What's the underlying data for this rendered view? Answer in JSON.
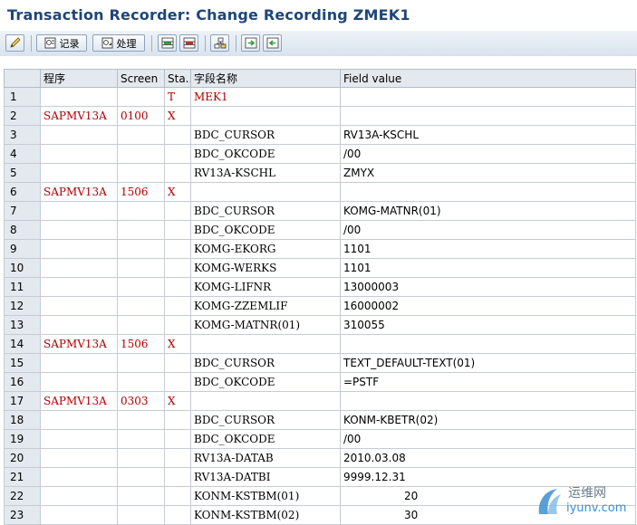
{
  "window": {
    "title": "Transaction Recorder: Change Recording ZMEK1"
  },
  "toolbar": {
    "record_label": "记录",
    "process_label": "处理",
    "accent": "#1e4678"
  },
  "columns": [
    "",
    "程序",
    "Screen",
    "Sta...",
    "字段名称",
    "Field value"
  ],
  "rows": [
    {
      "n": "1",
      "program": "",
      "screen": "",
      "start": "T",
      "field": "MEK1",
      "value": "",
      "field_red": true
    },
    {
      "n": "2",
      "program": "SAPMV13A",
      "screen": "0100",
      "start": "X",
      "field": "",
      "value": ""
    },
    {
      "n": "3",
      "program": "",
      "screen": "",
      "start": "",
      "field": "BDC_CURSOR",
      "value": "RV13A-KSCHL"
    },
    {
      "n": "4",
      "program": "",
      "screen": "",
      "start": "",
      "field": "BDC_OKCODE",
      "value": "/00"
    },
    {
      "n": "5",
      "program": "",
      "screen": "",
      "start": "",
      "field": "RV13A-KSCHL",
      "value": "ZMYX"
    },
    {
      "n": "6",
      "program": "SAPMV13A",
      "screen": "1506",
      "start": "X",
      "field": "",
      "value": ""
    },
    {
      "n": "7",
      "program": "",
      "screen": "",
      "start": "",
      "field": "BDC_CURSOR",
      "value": "KOMG-MATNR(01)"
    },
    {
      "n": "8",
      "program": "",
      "screen": "",
      "start": "",
      "field": "BDC_OKCODE",
      "value": "/00"
    },
    {
      "n": "9",
      "program": "",
      "screen": "",
      "start": "",
      "field": "KOMG-EKORG",
      "value": "1101"
    },
    {
      "n": "10",
      "program": "",
      "screen": "",
      "start": "",
      "field": "KOMG-WERKS",
      "value": "1101"
    },
    {
      "n": "11",
      "program": "",
      "screen": "",
      "start": "",
      "field": "KOMG-LIFNR",
      "value": "13000003"
    },
    {
      "n": "12",
      "program": "",
      "screen": "",
      "start": "",
      "field": "KOMG-ZZEMLIF",
      "value": "16000002"
    },
    {
      "n": "13",
      "program": "",
      "screen": "",
      "start": "",
      "field": "KOMG-MATNR(01)",
      "value": "310055"
    },
    {
      "n": "14",
      "program": "SAPMV13A",
      "screen": "1506",
      "start": "X",
      "field": "",
      "value": ""
    },
    {
      "n": "15",
      "program": "",
      "screen": "",
      "start": "",
      "field": "BDC_CURSOR",
      "value": "TEXT_DEFAULT-TEXT(01)"
    },
    {
      "n": "16",
      "program": "",
      "screen": "",
      "start": "",
      "field": "BDC_OKCODE",
      "value": "=PSTF"
    },
    {
      "n": "17",
      "program": "SAPMV13A",
      "screen": "0303",
      "start": "X",
      "field": "",
      "value": ""
    },
    {
      "n": "18",
      "program": "",
      "screen": "",
      "start": "",
      "field": "BDC_CURSOR",
      "value": "KONM-KBETR(02)"
    },
    {
      "n": "19",
      "program": "",
      "screen": "",
      "start": "",
      "field": "BDC_OKCODE",
      "value": "/00"
    },
    {
      "n": "20",
      "program": "",
      "screen": "",
      "start": "",
      "field": "RV13A-DATAB",
      "value": "2010.03.08"
    },
    {
      "n": "21",
      "program": "",
      "screen": "",
      "start": "",
      "field": "RV13A-DATBI",
      "value": "9999.12.31"
    },
    {
      "n": "22",
      "program": "",
      "screen": "",
      "start": "",
      "field": "KONM-KSTBM(01)",
      "value": "20",
      "value_right": true
    },
    {
      "n": "23",
      "program": "",
      "screen": "",
      "start": "",
      "field": "KONM-KSTBM(02)",
      "value": "30",
      "value_right": true
    }
  ],
  "watermark": {
    "line1": "运维网",
    "line2": "iyunv.com"
  }
}
